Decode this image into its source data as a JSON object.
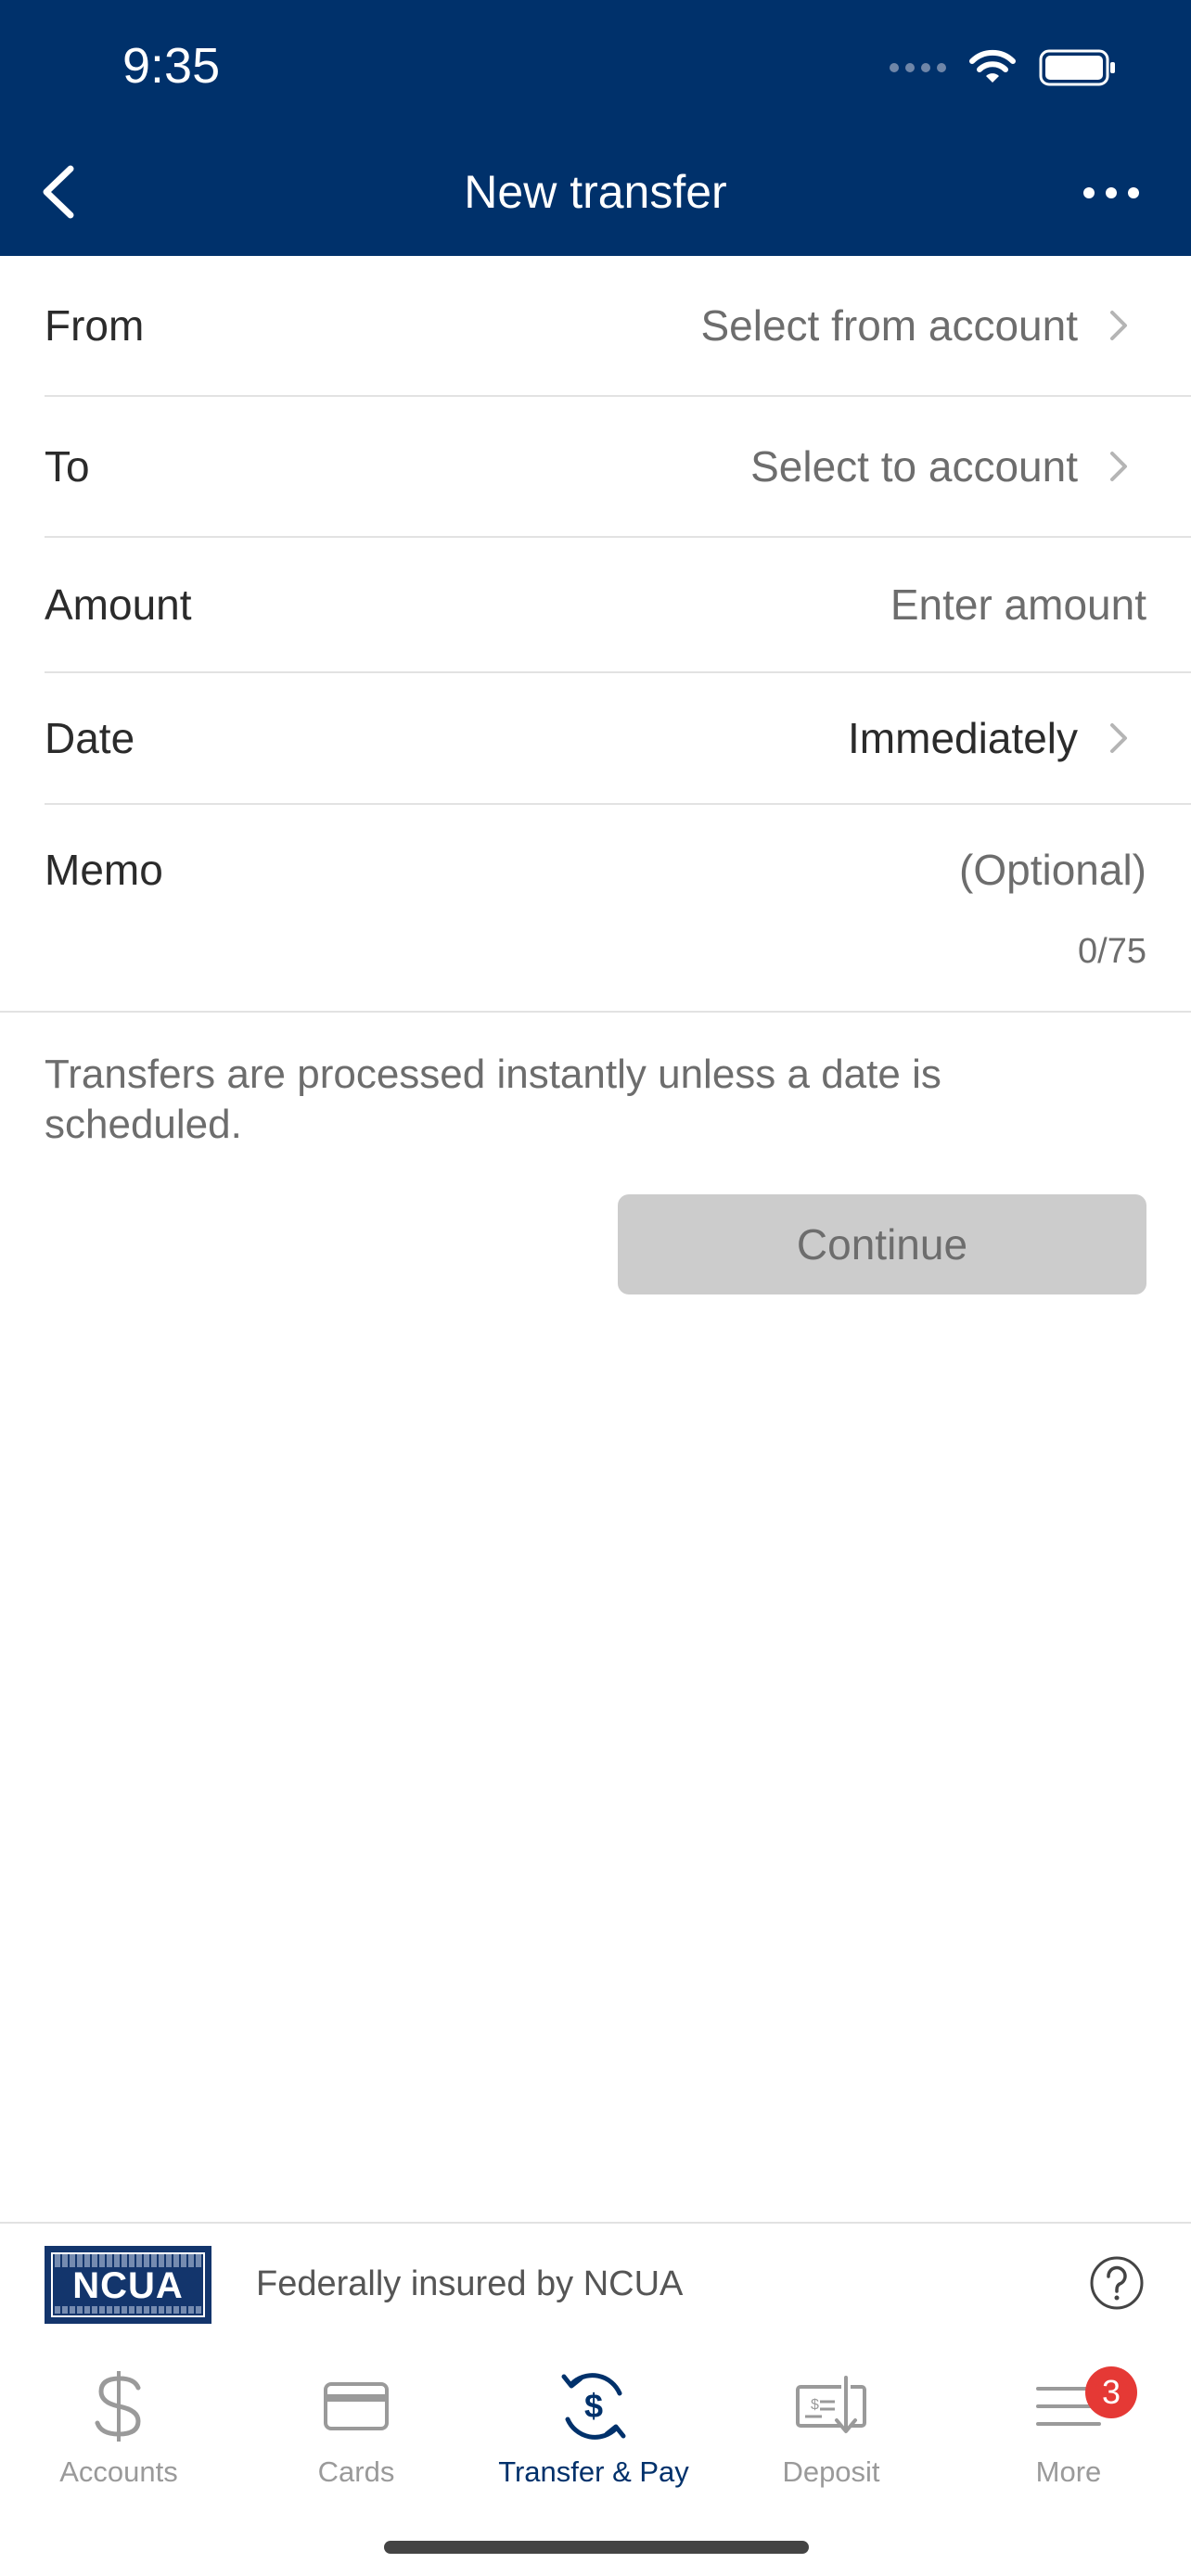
{
  "status_bar": {
    "time": "9:35",
    "icons": [
      "signal-icon",
      "wifi-icon",
      "battery-icon"
    ]
  },
  "nav": {
    "title": "New transfer",
    "back_icon": "chevron-left-icon",
    "more_icon": "ellipsis-icon"
  },
  "form": {
    "from": {
      "label": "From",
      "value": "Select from account"
    },
    "to": {
      "label": "To",
      "value": "Select to account"
    },
    "amount": {
      "label": "Amount",
      "placeholder": "Enter amount"
    },
    "date": {
      "label": "Date",
      "value": "Immediately"
    },
    "memo": {
      "label": "Memo",
      "placeholder": "(Optional)",
      "counter": "0/75"
    }
  },
  "info": "Transfers are processed instantly unless a date is scheduled.",
  "continue_label": "Continue",
  "ncua": {
    "logo_text": "NCUA",
    "text": "Federally insured by NCUA"
  },
  "tabs": [
    {
      "label": "Accounts",
      "icon": "dollar-icon"
    },
    {
      "label": "Cards",
      "icon": "credit-card-icon"
    },
    {
      "label": "Transfer & Pay",
      "icon": "transfer-icon"
    },
    {
      "label": "Deposit",
      "icon": "check-deposit-icon"
    },
    {
      "label": "More",
      "icon": "menu-icon",
      "badge": "3"
    }
  ],
  "colors": {
    "primary": "#00316b",
    "badge": "#e53935",
    "disabled_button": "#cccccc"
  }
}
